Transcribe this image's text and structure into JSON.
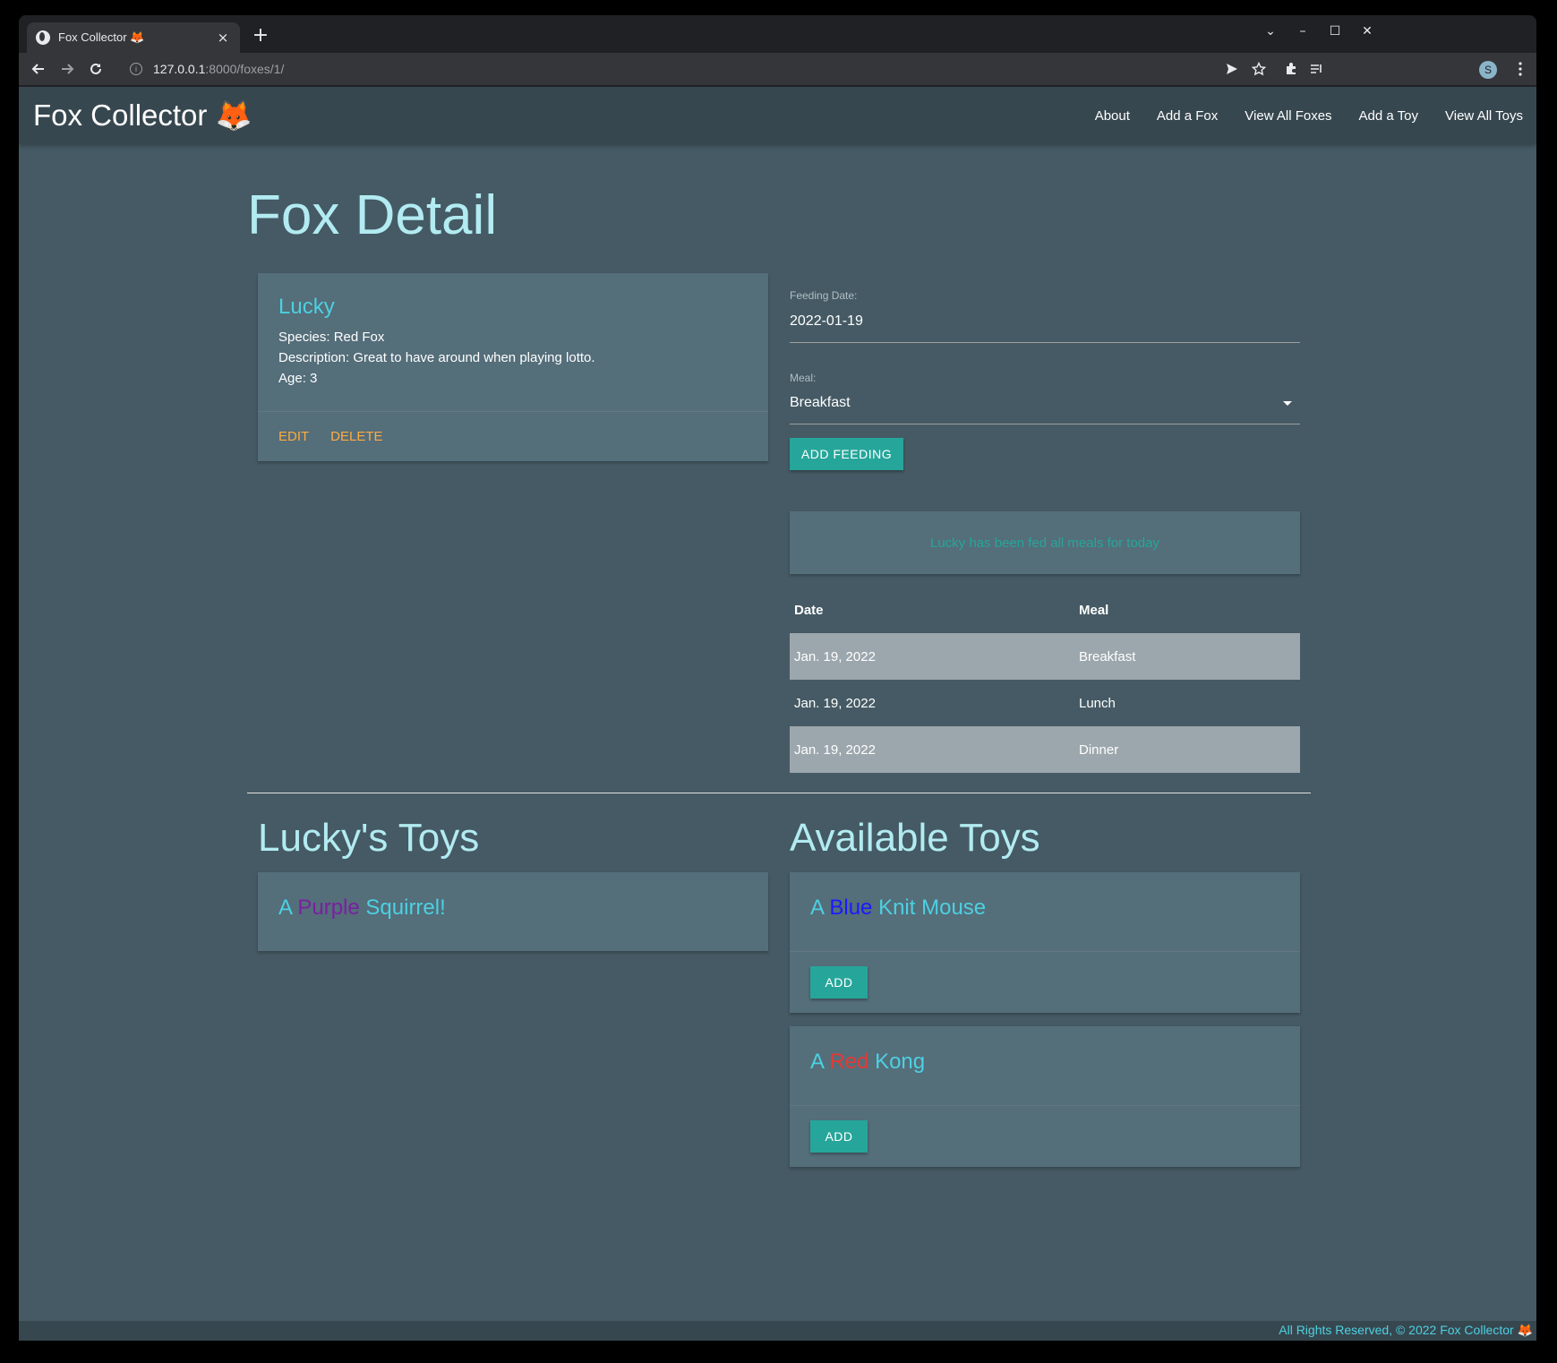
{
  "browser": {
    "tab_title": "Fox Collector 🦊",
    "tab_close": "×",
    "new_tab": "+",
    "url_host": "127.0.0.1",
    "url_rest": ":8000/foxes/1/",
    "avatar_letter": "S",
    "window_controls": [
      "⌄",
      "–",
      "☐",
      "✕"
    ]
  },
  "navbar": {
    "brand": "Fox Collector 🦊",
    "links": [
      "About",
      "Add a Fox",
      "View All Foxes",
      "Add a Toy",
      "View All Toys"
    ]
  },
  "page": {
    "title": "Fox Detail"
  },
  "fox": {
    "name": "Lucky",
    "species": "Species: Red Fox",
    "description": "Description: Great to have around when playing lotto.",
    "age": "Age: 3",
    "edit_label": "EDIT",
    "delete_label": "DELETE"
  },
  "feeding_form": {
    "date_label": "Feeding Date:",
    "date_value": "2022-01-19",
    "meal_label": "Meal:",
    "meal_value": "Breakfast",
    "submit_label": "ADD FEEDING"
  },
  "feeding_notice": "Lucky has been fed all meals for today",
  "feedings": {
    "headers": [
      "Date",
      "Meal"
    ],
    "rows": [
      [
        "Jan. 19, 2022",
        "Breakfast"
      ],
      [
        "Jan. 19, 2022",
        "Lunch"
      ],
      [
        "Jan. 19, 2022",
        "Dinner"
      ]
    ]
  },
  "toys": {
    "owned_title": "Lucky's Toys",
    "available_title": "Available Toys",
    "owned": [
      {
        "prefix": "A",
        "color_word": "Purple",
        "color": "#7b1fa2",
        "rest": "Squirrel!"
      }
    ],
    "available": [
      {
        "prefix": "A",
        "color_word": "Blue",
        "color": "#1a1aff",
        "rest": "Knit Mouse",
        "button": "ADD"
      },
      {
        "prefix": "A",
        "color_word": "Red",
        "color": "#e53935",
        "rest": "Kong",
        "button": "ADD"
      }
    ]
  },
  "footer": {
    "text": "All Rights Reserved, © 2022 Fox Collector 🦊"
  },
  "colors": {
    "page_bg": "#455a64",
    "navbar_bg": "#37474f",
    "card_bg": "#546e7a",
    "accent_teal": "#26a69a",
    "accent_orange": "#ffab40",
    "title_cyan": "#b2ebf2",
    "link_cyan": "#4dd0e1"
  }
}
